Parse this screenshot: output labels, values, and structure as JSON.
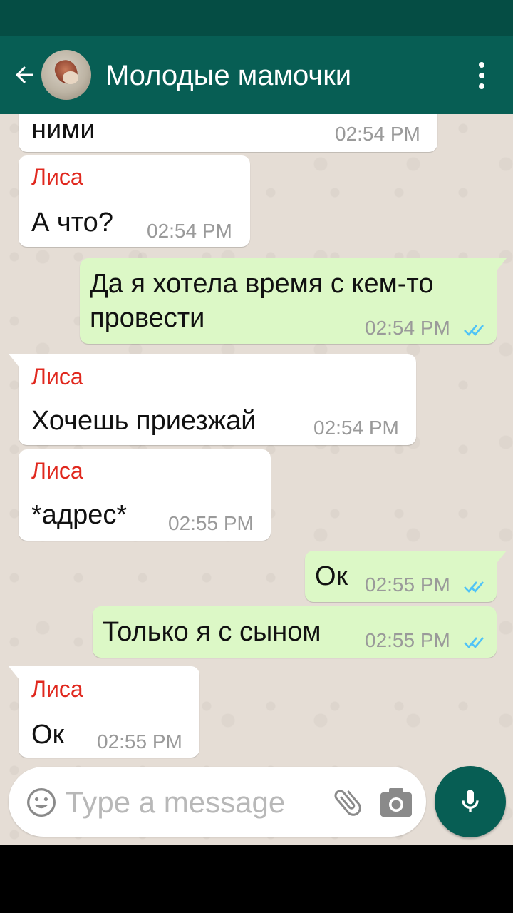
{
  "header": {
    "title": "Молодые мамочки",
    "back_icon": "arrow-left-icon",
    "menu_icon": "more-vert-icon"
  },
  "colors": {
    "app_bar": "#075e54",
    "status_bar": "#054d44",
    "incoming_bubble": "#ffffff",
    "outgoing_bubble": "#dcf8c6",
    "sender_name": "#e0281e",
    "read_ticks": "#4fc3f7",
    "chat_background": "#e5ddd5"
  },
  "messages": [
    {
      "direction": "in",
      "sender": "",
      "text": "ними",
      "time": "02:54 PM"
    },
    {
      "direction": "in",
      "sender": "Лиса",
      "text": "А что?",
      "time": "02:54 PM"
    },
    {
      "direction": "out",
      "text_line1": "Да я хотела время с кем-то",
      "text_line2": "провести",
      "time": "02:54 PM",
      "status": "read"
    },
    {
      "direction": "in",
      "sender": "Лиса",
      "text": "Хочешь приезжай",
      "time": "02:54 PM"
    },
    {
      "direction": "in",
      "sender": "Лиса",
      "text": "*адрес*",
      "time": "02:55 PM"
    },
    {
      "direction": "out",
      "text": "Ок",
      "time": "02:55 PM",
      "status": "read"
    },
    {
      "direction": "out",
      "text": "Только я с сыном",
      "time": "02:55 PM",
      "status": "read"
    },
    {
      "direction": "in",
      "sender": "Лиса",
      "text": "Ок",
      "time": "02:55 PM"
    }
  ],
  "composer": {
    "placeholder": "Type a message",
    "emoji_icon": "emoji-icon",
    "attach_icon": "paperclip-icon",
    "camera_icon": "camera-icon",
    "mic_icon": "microphone-icon"
  }
}
